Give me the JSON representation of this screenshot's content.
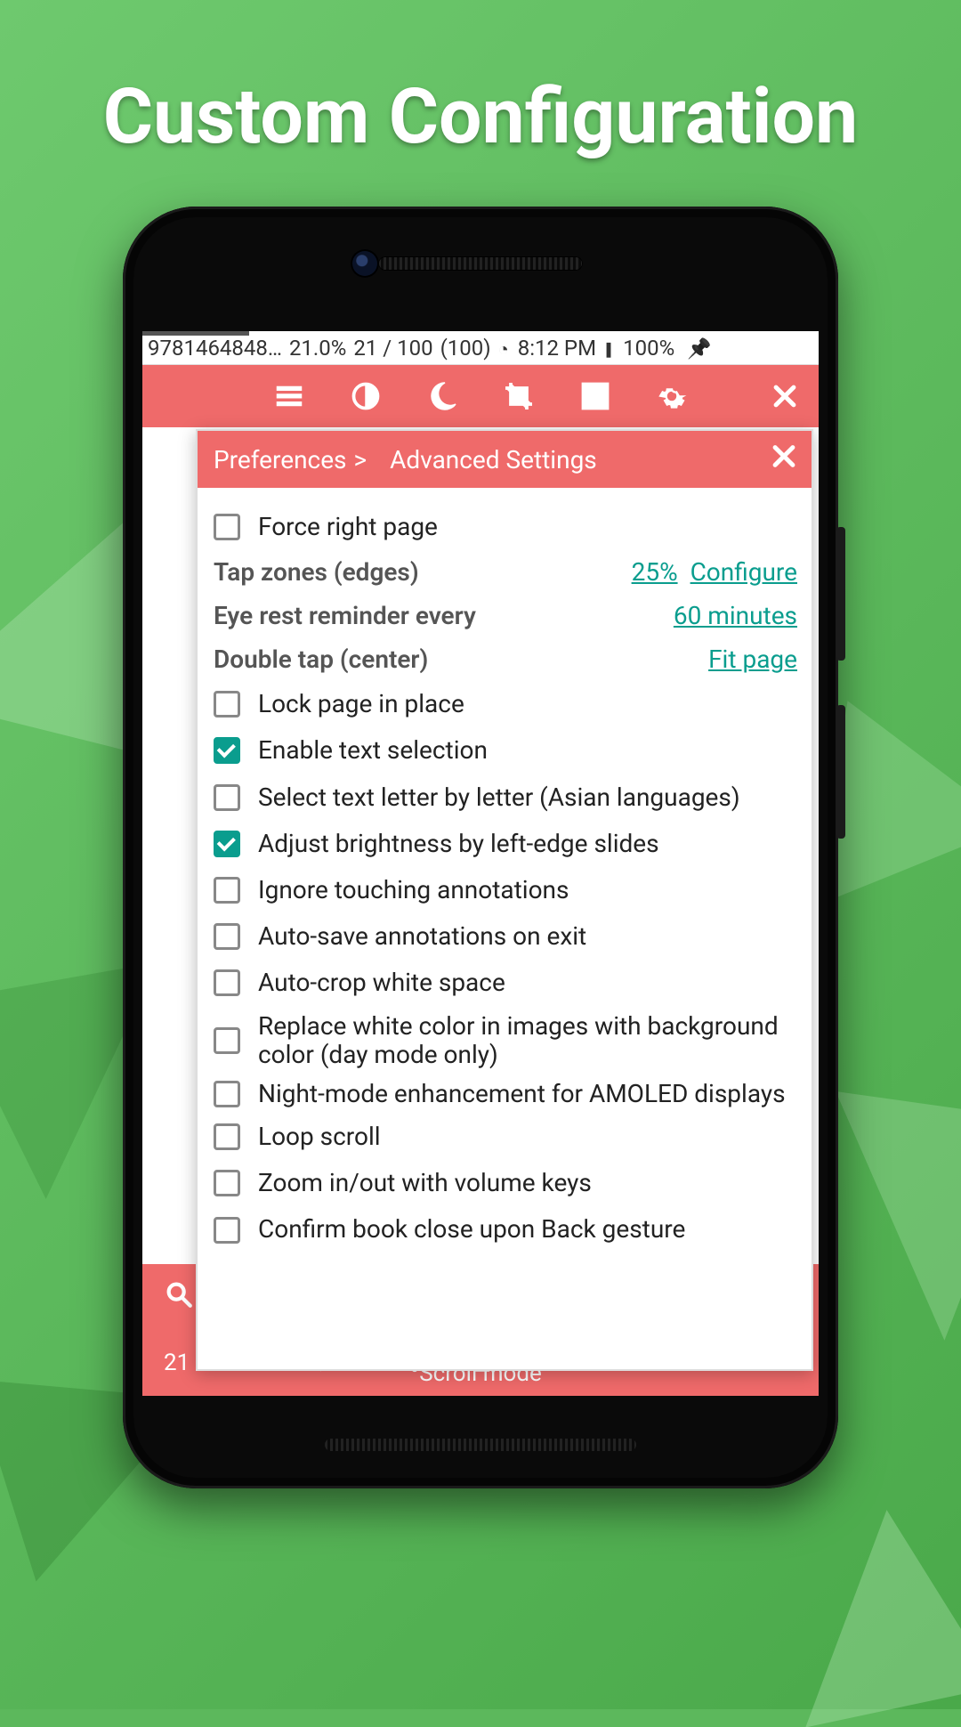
{
  "hero_title": "Custom Configuration",
  "status": {
    "file_id": "9781464848…",
    "zoom": "21.0%",
    "page": "21 / 100",
    "total": "(100)",
    "time": "8:12 PM",
    "battery": "100%"
  },
  "toolbar_icons": [
    "menu-icon",
    "contrast-icon",
    "moon-icon",
    "crop-icon",
    "fit-screen-icon",
    "gear-icon",
    "close-icon"
  ],
  "prefs": {
    "crumb1": "Preferences",
    "crumb_sep": ">",
    "crumb2": "Advanced Settings",
    "force_right_page": {
      "label": "Force right page",
      "checked": false
    },
    "tap_zones": {
      "label": "Tap zones (edges)",
      "value1": "25%",
      "value2": "Configure"
    },
    "eye_rest": {
      "label": "Eye rest reminder every",
      "value": "60 minutes"
    },
    "double_tap": {
      "label": "Double tap (center)",
      "value": "Fit page"
    },
    "lock_page": {
      "label": "Lock page in place",
      "checked": false
    },
    "enable_text_sel": {
      "label": "Enable text selection",
      "checked": true
    },
    "asian": {
      "label": "Select text letter by letter (Asian languages)",
      "checked": false
    },
    "brightness_edge": {
      "label": "Adjust brightness by left-edge slides",
      "checked": true
    },
    "ignore_annot": {
      "label": "Ignore touching annotations",
      "checked": false
    },
    "autosave_annot": {
      "label": "Auto-save annotations on exit",
      "checked": false
    },
    "autocrop": {
      "label": "Auto-crop white space",
      "checked": false
    },
    "replace_white": {
      "label": "Replace white color in images with background color (day mode only)",
      "checked": false
    },
    "amoled": {
      "label": "Night-mode enhancement for AMOLED displays",
      "checked": false
    },
    "loop_scroll": {
      "label": "Loop scroll",
      "checked": false
    },
    "zoom_vol": {
      "label": "Zoom in/out with volume keys",
      "checked": false
    },
    "confirm_close": {
      "label": "Confirm book close upon Back gesture",
      "checked": false
    }
  },
  "footer": {
    "page_num": "21",
    "mode_label": "Scroll mode"
  }
}
